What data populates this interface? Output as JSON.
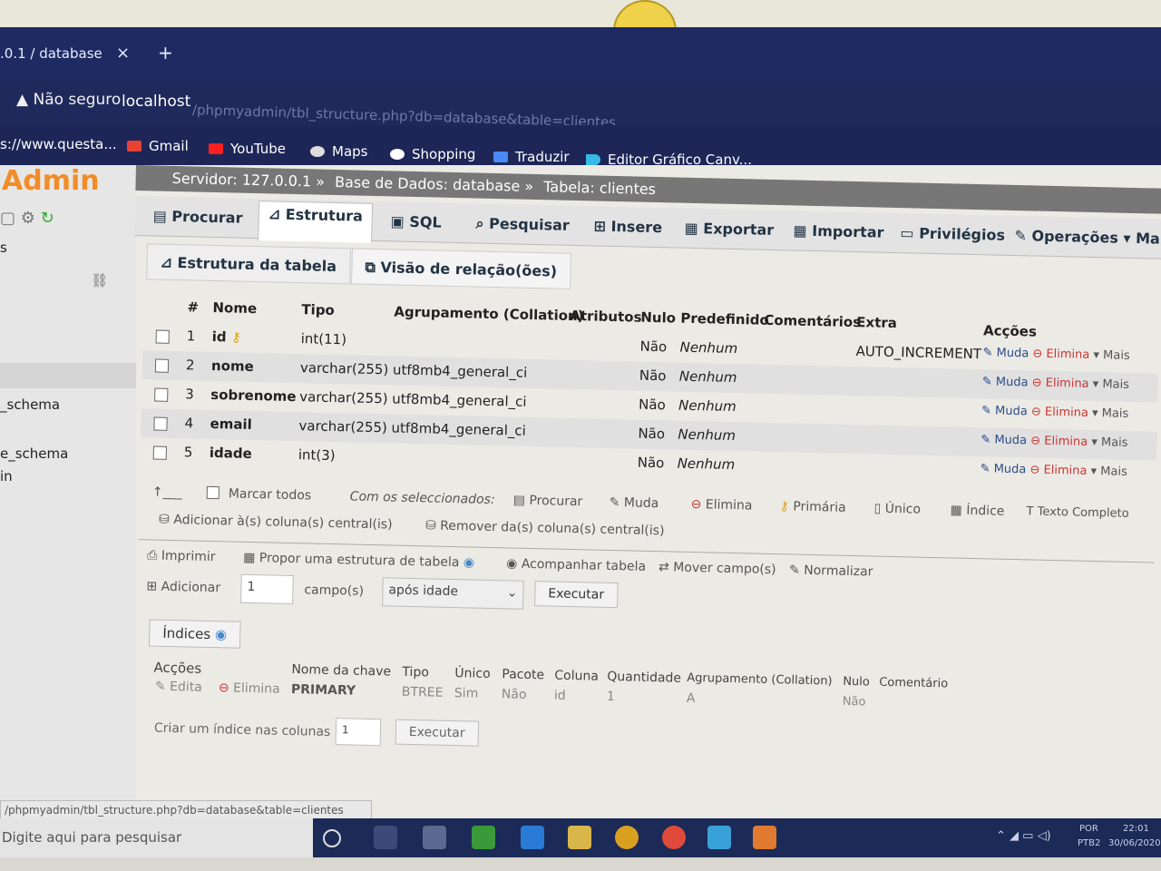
{
  "browser": {
    "tab_title": ".0.1 / database",
    "tab_close": "×",
    "new_tab": "+",
    "security": "Não seguro",
    "host": "localhost",
    "path": "/phpmyadmin/tbl_structure.php?db=database&table=clientes",
    "bookmarks": [
      "s://www.questa...",
      "Gmail",
      "YouTube",
      "Maps",
      "Shopping",
      "Traduzir",
      "Editor Gráfico Canv..."
    ]
  },
  "sidebar": {
    "logo": "Admin",
    "items": [
      "s",
      "_schema",
      "e_schema",
      "in"
    ]
  },
  "breadcrumb": {
    "server": "Servidor: 127.0.0.1 »",
    "database": "Base de Dados: database »",
    "table": "Tabela: clientes"
  },
  "menu": [
    "Procurar",
    "Estrutura",
    "SQL",
    "Pesquisar",
    "Insere",
    "Exportar",
    "Importar",
    "Privilégios",
    "Operações",
    "Mais"
  ],
  "subtabs": [
    "Estrutura da tabela",
    "Visão de relação(ões)"
  ],
  "columns_header": [
    "#",
    "Nome",
    "Tipo",
    "Agrupamento (Collation)",
    "Atributos",
    "Nulo",
    "Predefinido",
    "Comentários",
    "Extra",
    "Acções"
  ],
  "rows": [
    {
      "num": "1",
      "name": "id",
      "type": "int(11)",
      "collation": "",
      "null": "Não",
      "default": "Nenhum",
      "extra": "AUTO_INCREMENT"
    },
    {
      "num": "2",
      "name": "nome",
      "type": "varchar(255)",
      "collation": "utf8mb4_general_ci",
      "null": "Não",
      "default": "Nenhum",
      "extra": ""
    },
    {
      "num": "3",
      "name": "sobrenome",
      "type": "varchar(255)",
      "collation": "utf8mb4_general_ci",
      "null": "Não",
      "default": "Nenhum",
      "extra": ""
    },
    {
      "num": "4",
      "name": "email",
      "type": "varchar(255)",
      "collation": "utf8mb4_general_ci",
      "null": "Não",
      "default": "Nenhum",
      "extra": ""
    },
    {
      "num": "5",
      "name": "idade",
      "type": "int(3)",
      "collation": "",
      "null": "Não",
      "default": "Nenhum",
      "extra": ""
    }
  ],
  "row_actions": {
    "change": "Muda",
    "drop": "Elimina",
    "more": "Mais"
  },
  "bulk": {
    "check_all": "Marcar todos",
    "with_selected": "Com os seleccionados:",
    "browse": "Procurar",
    "change": "Muda",
    "drop": "Elimina",
    "primary": "Primária",
    "unique": "Único",
    "index": "Índice",
    "fulltext": "Texto Completo",
    "add_central": "Adicionar à(s) coluna(s) central(is)",
    "remove_central": "Remover da(s) coluna(s) central(is)"
  },
  "tools": {
    "print": "Imprimir",
    "propose": "Propor uma estrutura de tabela",
    "track": "Acompanhar tabela",
    "move": "Mover campo(s)",
    "normalize": "Normalizar",
    "add_label": "Adicionar",
    "add_count": "1",
    "fields_label": "campo(s)",
    "position": "após idade",
    "execute": "Executar"
  },
  "indexes": {
    "title": "Índices",
    "header": [
      "Acções",
      "Nome da chave",
      "Tipo",
      "Único",
      "Pacote",
      "Coluna",
      "Quantidade",
      "Agrupamento (Collation)",
      "Nulo",
      "Comentário"
    ],
    "row": {
      "edit": "Edita",
      "drop": "Elimina",
      "key": "PRIMARY",
      "type": "BTREE",
      "unique": "Sim",
      "packed": "Não",
      "column": "id",
      "cardinality": "1",
      "collation": "A",
      "null": "Não"
    },
    "create_label": "Criar um índice nas colunas",
    "create_count": "1",
    "execute": "Executar"
  },
  "status_url": "/phpmyadmin/tbl_structure.php?db=database&table=clientes",
  "taskbar": {
    "search": "Digite aqui para pesquisar",
    "lang": "POR",
    "layout": "PTB2",
    "time": "22:01",
    "date": "30/06/2020"
  }
}
